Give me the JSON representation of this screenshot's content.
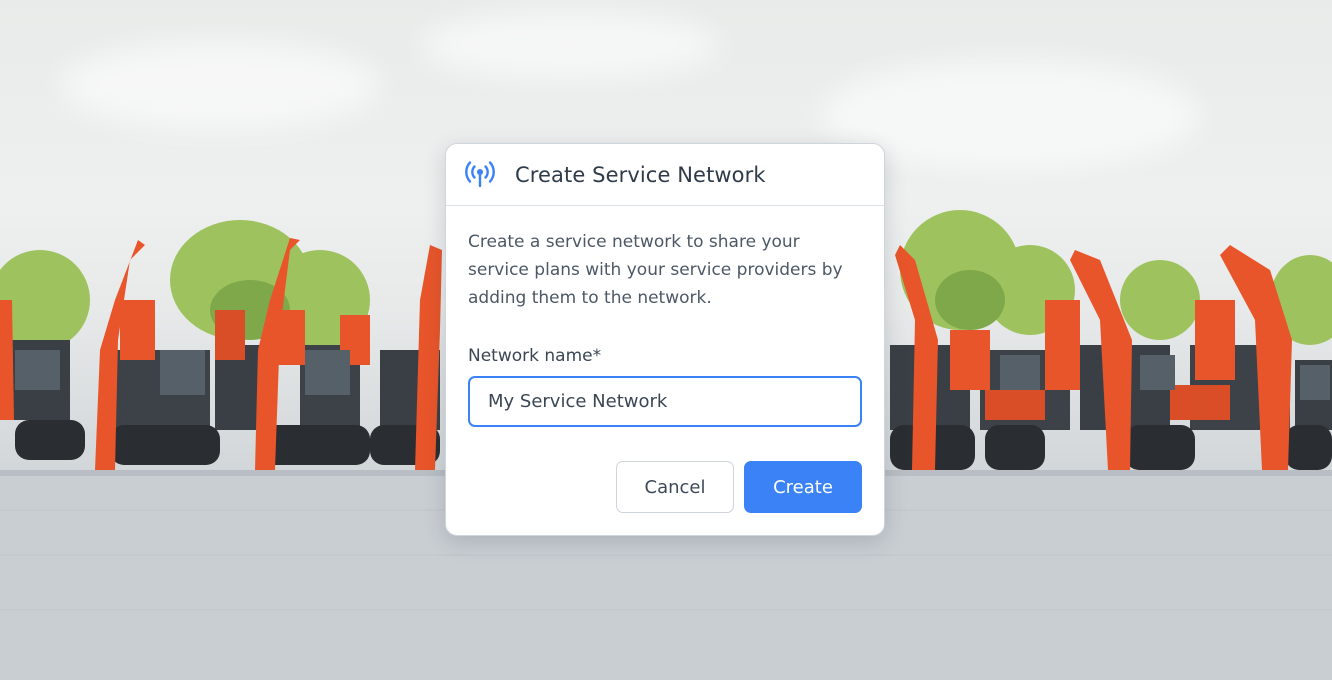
{
  "dialog": {
    "icon": "broadcast-antenna-icon",
    "title": "Create Service Network",
    "description": "Create a service network to share your service plans with your service providers by adding them to the network.",
    "field_label": "Network name*",
    "input_value": "My Service Network",
    "cancel_label": "Cancel",
    "create_label": "Create"
  },
  "colors": {
    "accent": "#3b82f6",
    "title_text": "#2f3b4a",
    "body_text": "#4c5866",
    "excavator_orange": "#e8552a"
  },
  "background": {
    "icon": "excavator-yard-photo"
  }
}
